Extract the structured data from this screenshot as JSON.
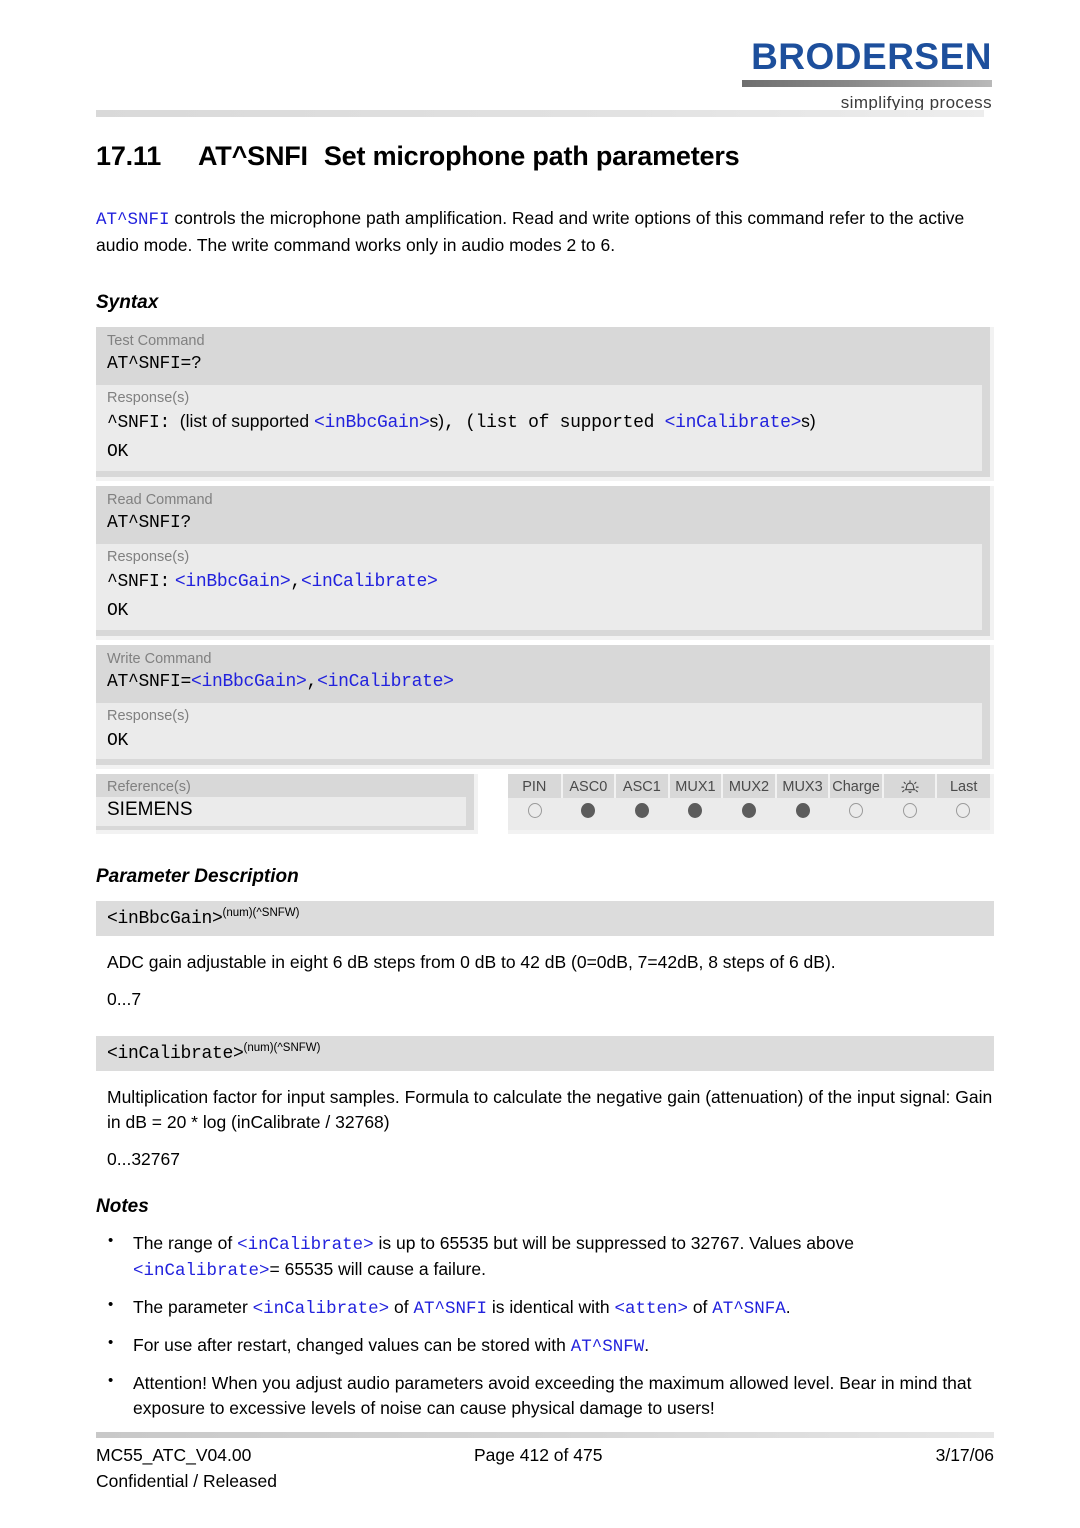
{
  "header": {
    "logo_word": "BRODERSEN",
    "logo_tagline": "simplifying process",
    "brand_color": "#1d4f9c"
  },
  "title": {
    "number": "17.11",
    "command": "AT^SNFI",
    "text": "Set microphone path parameters"
  },
  "intro": {
    "cmd": "AT^SNFI",
    "rest": " controls the microphone path amplification. Read and write options of this command refer to the active audio mode. The write command works only in audio modes 2 to 6."
  },
  "sections": {
    "syntax": "Syntax",
    "parameter_description": "Parameter Description",
    "notes": "Notes"
  },
  "syntax": {
    "blocks": [
      {
        "label": "Test Command",
        "command_prefix": "AT^SNFI=?",
        "command_params": "",
        "response_label": "Response(s)",
        "response_prefix": "^SNFI:",
        "response_mid1": "(list of supported ",
        "response_param1": "<inBbcGain>",
        "response_mid2": "s)",
        "response_mid3": ", (list of supported ",
        "response_param2": "<inCalibrate>",
        "response_mid4": "s)",
        "response_ok": "OK"
      },
      {
        "label": "Read Command",
        "command_prefix": "AT^SNFI?",
        "command_params": "",
        "response_label": "Response(s)",
        "response_prefix": "^SNFI:",
        "response_param1": "<inBbcGain>",
        "response_sep": ",",
        "response_param2": "<inCalibrate>",
        "response_ok": "OK"
      },
      {
        "label": "Write Command",
        "command_prefix": "AT^SNFI=",
        "command_param1": "<inBbcGain>",
        "command_sep": ",",
        "command_param2": "<inCalibrate>",
        "response_label": "Response(s)",
        "response_ok": "OK"
      }
    ],
    "reference": {
      "label": "Reference(s)",
      "value": "SIEMENS"
    },
    "signal_table": {
      "columns": [
        "PIN",
        "ASC0",
        "ASC1",
        "MUX1",
        "MUX2",
        "MUX3",
        "Charge",
        "alarm-bell-icon",
        "Last"
      ],
      "states": [
        "empty",
        "filled",
        "filled",
        "filled",
        "filled",
        "filled",
        "empty",
        "empty",
        "empty"
      ]
    }
  },
  "parameters": [
    {
      "name": "<inBbcGain>",
      "superscript": "(num)(^SNFW)",
      "description": "ADC gain adjustable in eight 6 dB steps from 0 dB to 42 dB (0=0dB, 7=42dB, 8 steps of 6 dB).",
      "range": "0...7"
    },
    {
      "name": "<inCalibrate>",
      "superscript": "(num)(^SNFW)",
      "description": "Multiplication factor for input samples. Formula to calculate the negative gain (attenuation) of the input signal: Gain in dB = 20 * log (inCalibrate / 32768)",
      "range": "0...32767"
    }
  ],
  "notes": [
    {
      "t1": "The range of ",
      "p1": "<inCalibrate>",
      "t2": " is up to 65535 but will be suppressed to 32767. Values above ",
      "p2": "<inCalibrate>",
      "t3": "= 65535 will cause a failure."
    },
    {
      "t1": "The parameter ",
      "p1": "<inCalibrate>",
      "t2": " of ",
      "p2": "AT^SNFI",
      "t3": " is identical with ",
      "p3": "<atten>",
      "t4": " of ",
      "p4": "AT^SNFA",
      "t5": "."
    },
    {
      "t1": "For use after restart, changed values can be stored with ",
      "p1": "AT^SNFW",
      "t2": "."
    },
    {
      "t1": "Attention! When you adjust audio parameters avoid exceeding the maximum allowed level. Bear in mind that exposure to excessive levels of noise can cause physical damage to users!"
    }
  ],
  "footer": {
    "document": "MC55_ATC_V04.00",
    "classification": "Confidential / Released",
    "page": "Page 412 of 475",
    "date": "3/17/06"
  }
}
